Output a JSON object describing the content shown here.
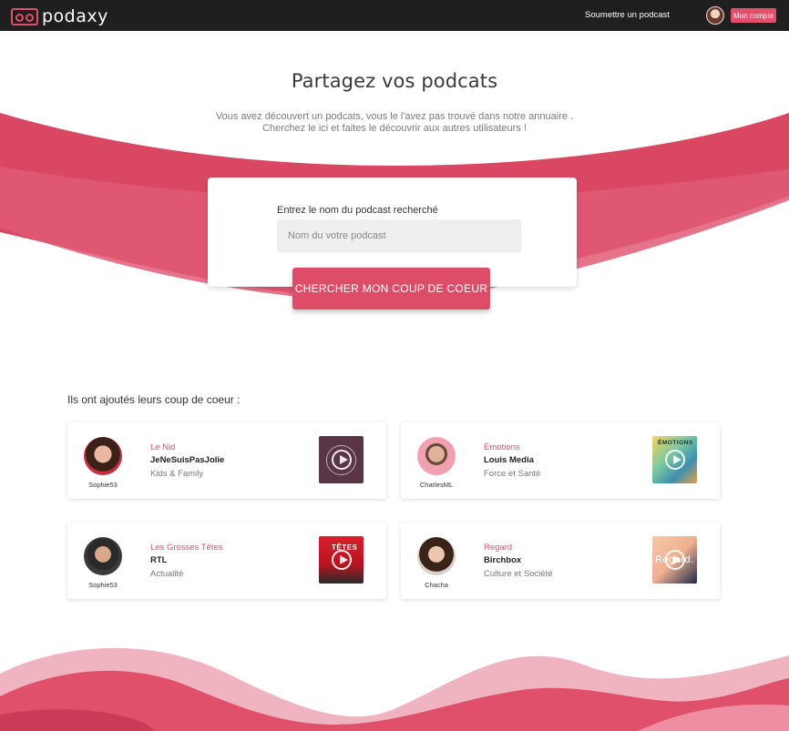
{
  "header": {
    "brand": "podaxy",
    "submit_link": "Soumettre un podcast",
    "account_button": "Mon compte"
  },
  "hero": {
    "title": "Partagez vos podcats",
    "subtitle_line1": "Vous avez découvert un podcats, vous le l'avez pas trouvé dans notre annuaire .",
    "subtitle_line2": "Cherchez le ici et faites le découvrir aux autres utilisateurs !"
  },
  "search": {
    "label": "Entrez le nom du podcast recherché",
    "placeholder": "Nom du votre podcast",
    "button": "CHERCHER MON COUP DE COEUR"
  },
  "favorites": {
    "title": "Ils ont ajoutés leurs coup de coeur :",
    "items": [
      {
        "user": "Sophie53",
        "title": "Le Nid",
        "author": "JeNeSuisPasJolie",
        "category": "Kids & Family"
      },
      {
        "user": "CharlesML",
        "title": "Émotions",
        "author": "Louis Media",
        "category": "Force et Santé",
        "cover_text": "ÉMOTIONS"
      },
      {
        "user": "Sophie53",
        "title": "Les Grosses Têtes",
        "author": "RTL",
        "category": "Actualité",
        "cover_text": "TÊTES"
      },
      {
        "user": "Chacha",
        "title": "Regard",
        "author": "Birchbox",
        "category": "Culture et Société",
        "cover_text": "Regard."
      }
    ]
  },
  "colors": {
    "accent": "#e0506a",
    "wave_dark": "#d94763",
    "wave_light": "#ec9aab",
    "topbar": "#1f1f1f"
  },
  "icons": {
    "logo": "cassette-icon",
    "play": "play-circle-icon"
  }
}
